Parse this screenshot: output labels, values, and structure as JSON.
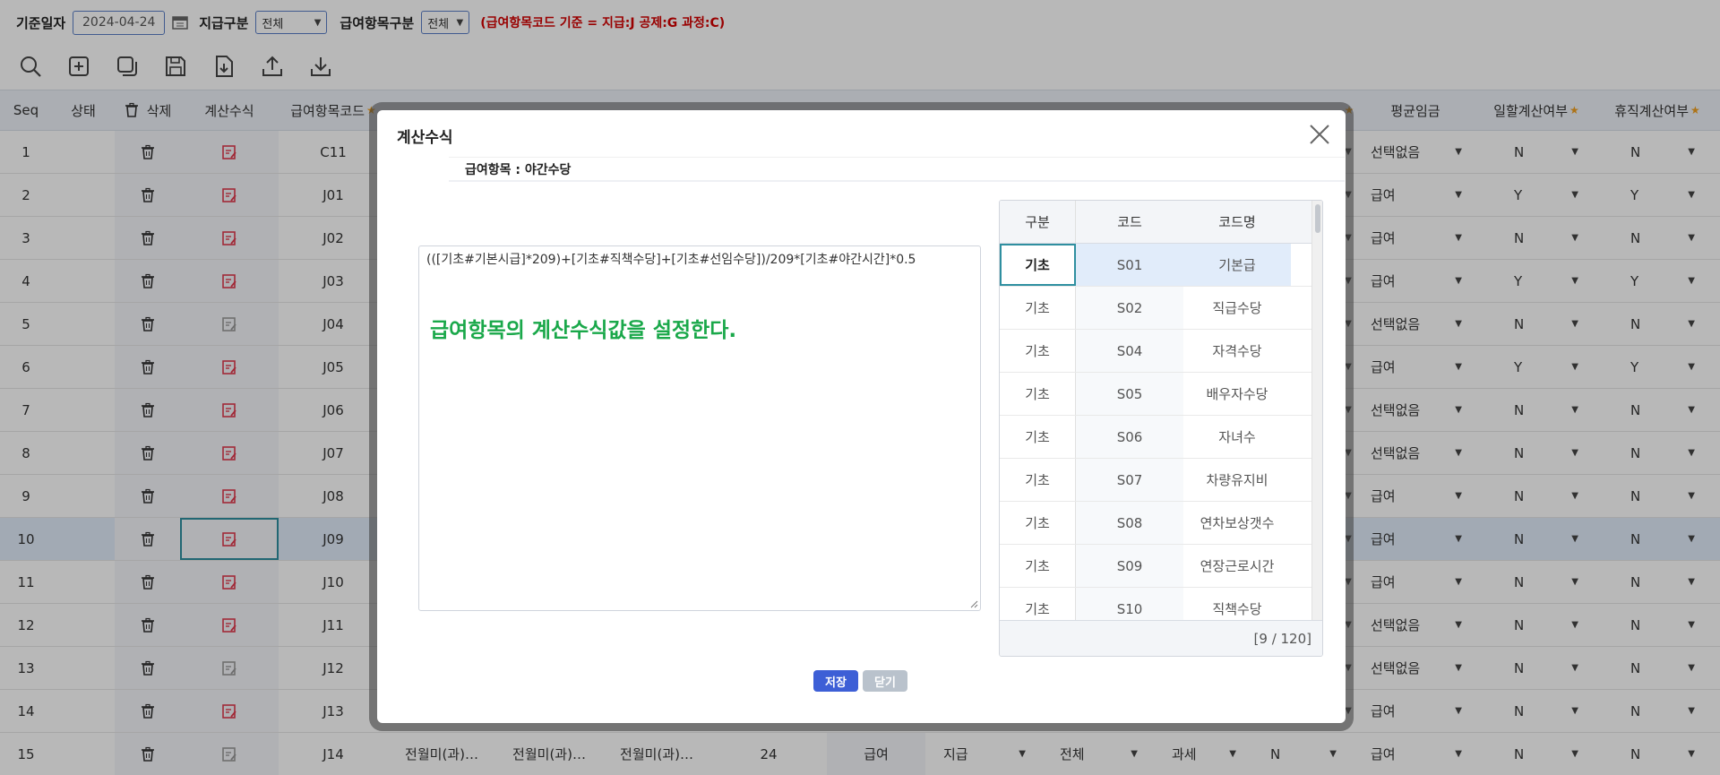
{
  "filter": {
    "date_label": "기준일자",
    "date_value": "2024-04-24",
    "pay_type_label": "지급구분",
    "pay_type_value": "전체",
    "item_type_label": "급여항목구분",
    "item_type_value": "전체",
    "notice": "(급여항목코드 기준 = 지급:J 공제:G 과정:C)"
  },
  "toolbar": [
    "search-icon",
    "add-icon",
    "copy-icon",
    "save-icon",
    "export-file-icon",
    "upload-icon",
    "download-icon"
  ],
  "grid": {
    "headers": {
      "seq": "Seq",
      "status": "상태",
      "delete": "삭제",
      "formula": "계산수식",
      "code": "급여항목코드",
      "avg_wage": "평균임금",
      "daily_calc": "일할계산여부",
      "leave_calc": "휴직계산여부"
    },
    "rows": [
      {
        "seq": "1",
        "code": "C11",
        "avg": "선택없음",
        "daily": "N",
        "leave": "N",
        "faded": false
      },
      {
        "seq": "2",
        "code": "J01",
        "avg": "급여",
        "daily": "Y",
        "leave": "Y",
        "faded": false
      },
      {
        "seq": "3",
        "code": "J02",
        "avg": "급여",
        "daily": "N",
        "leave": "N",
        "faded": false
      },
      {
        "seq": "4",
        "code": "J03",
        "avg": "급여",
        "daily": "Y",
        "leave": "Y",
        "faded": false
      },
      {
        "seq": "5",
        "code": "J04",
        "avg": "선택없음",
        "daily": "N",
        "leave": "N",
        "faded": true
      },
      {
        "seq": "6",
        "code": "J05",
        "avg": "급여",
        "daily": "Y",
        "leave": "Y",
        "faded": false
      },
      {
        "seq": "7",
        "code": "J06",
        "avg": "선택없음",
        "daily": "N",
        "leave": "N",
        "faded": false
      },
      {
        "seq": "8",
        "code": "J07",
        "avg": "선택없음",
        "daily": "N",
        "leave": "N",
        "faded": false
      },
      {
        "seq": "9",
        "code": "J08",
        "avg": "급여",
        "daily": "N",
        "leave": "N",
        "faded": false
      },
      {
        "seq": "10",
        "code": "J09",
        "avg": "급여",
        "daily": "N",
        "leave": "N",
        "faded": false
      },
      {
        "seq": "11",
        "code": "J10",
        "avg": "급여",
        "daily": "N",
        "leave": "N",
        "faded": false
      },
      {
        "seq": "12",
        "code": "J11",
        "avg": "선택없음",
        "daily": "N",
        "leave": "N",
        "faded": false
      },
      {
        "seq": "13",
        "code": "J12",
        "avg": "선택없음",
        "daily": "N",
        "leave": "N",
        "faded": true
      },
      {
        "seq": "14",
        "code": "J13",
        "avg": "급여",
        "daily": "N",
        "leave": "N",
        "faded": false
      },
      {
        "seq": "15",
        "code": "J14",
        "avg": "급여",
        "daily": "N",
        "leave": "N",
        "faded": true
      }
    ],
    "row15_extra": {
      "c1": "전월미(과)…",
      "c2": "전월미(과)…",
      "c3": "전월미(과)…",
      "num": "24",
      "pay": "급여",
      "give": "지급",
      "all": "전체",
      "tax": "과세",
      "n": "N"
    }
  },
  "modal": {
    "title": "계산수식",
    "subtitle": "급여항목 : 야간수당",
    "formula": "(([기초#기본시급]*209)+[기초#직책수당]+[기초#선임수당])/209*[기초#야간시간]*0.5",
    "hint": "급여항목의 계산수식값을 설정한다.",
    "save": "저장",
    "close": "닫기",
    "side": {
      "headers": [
        "구분",
        "코드",
        "코드명"
      ],
      "rows": [
        [
          "기초",
          "S01",
          "기본급"
        ],
        [
          "기초",
          "S02",
          "직급수당"
        ],
        [
          "기초",
          "S04",
          "자격수당"
        ],
        [
          "기초",
          "S05",
          "배우자수당"
        ],
        [
          "기초",
          "S06",
          "자녀수"
        ],
        [
          "기초",
          "S07",
          "차량유지비"
        ],
        [
          "기초",
          "S08",
          "연차보상갯수"
        ],
        [
          "기초",
          "S09",
          "연장근로시간"
        ],
        [
          "기초",
          "S10",
          "직책수당"
        ]
      ],
      "footer": "[9 / 120]"
    }
  },
  "colors": {
    "accent": "#3d5fd6",
    "notice": "#d40000",
    "hint": "#1aa84a",
    "edit_icon": "#e0394d",
    "focus": "#2f8fa0"
  }
}
